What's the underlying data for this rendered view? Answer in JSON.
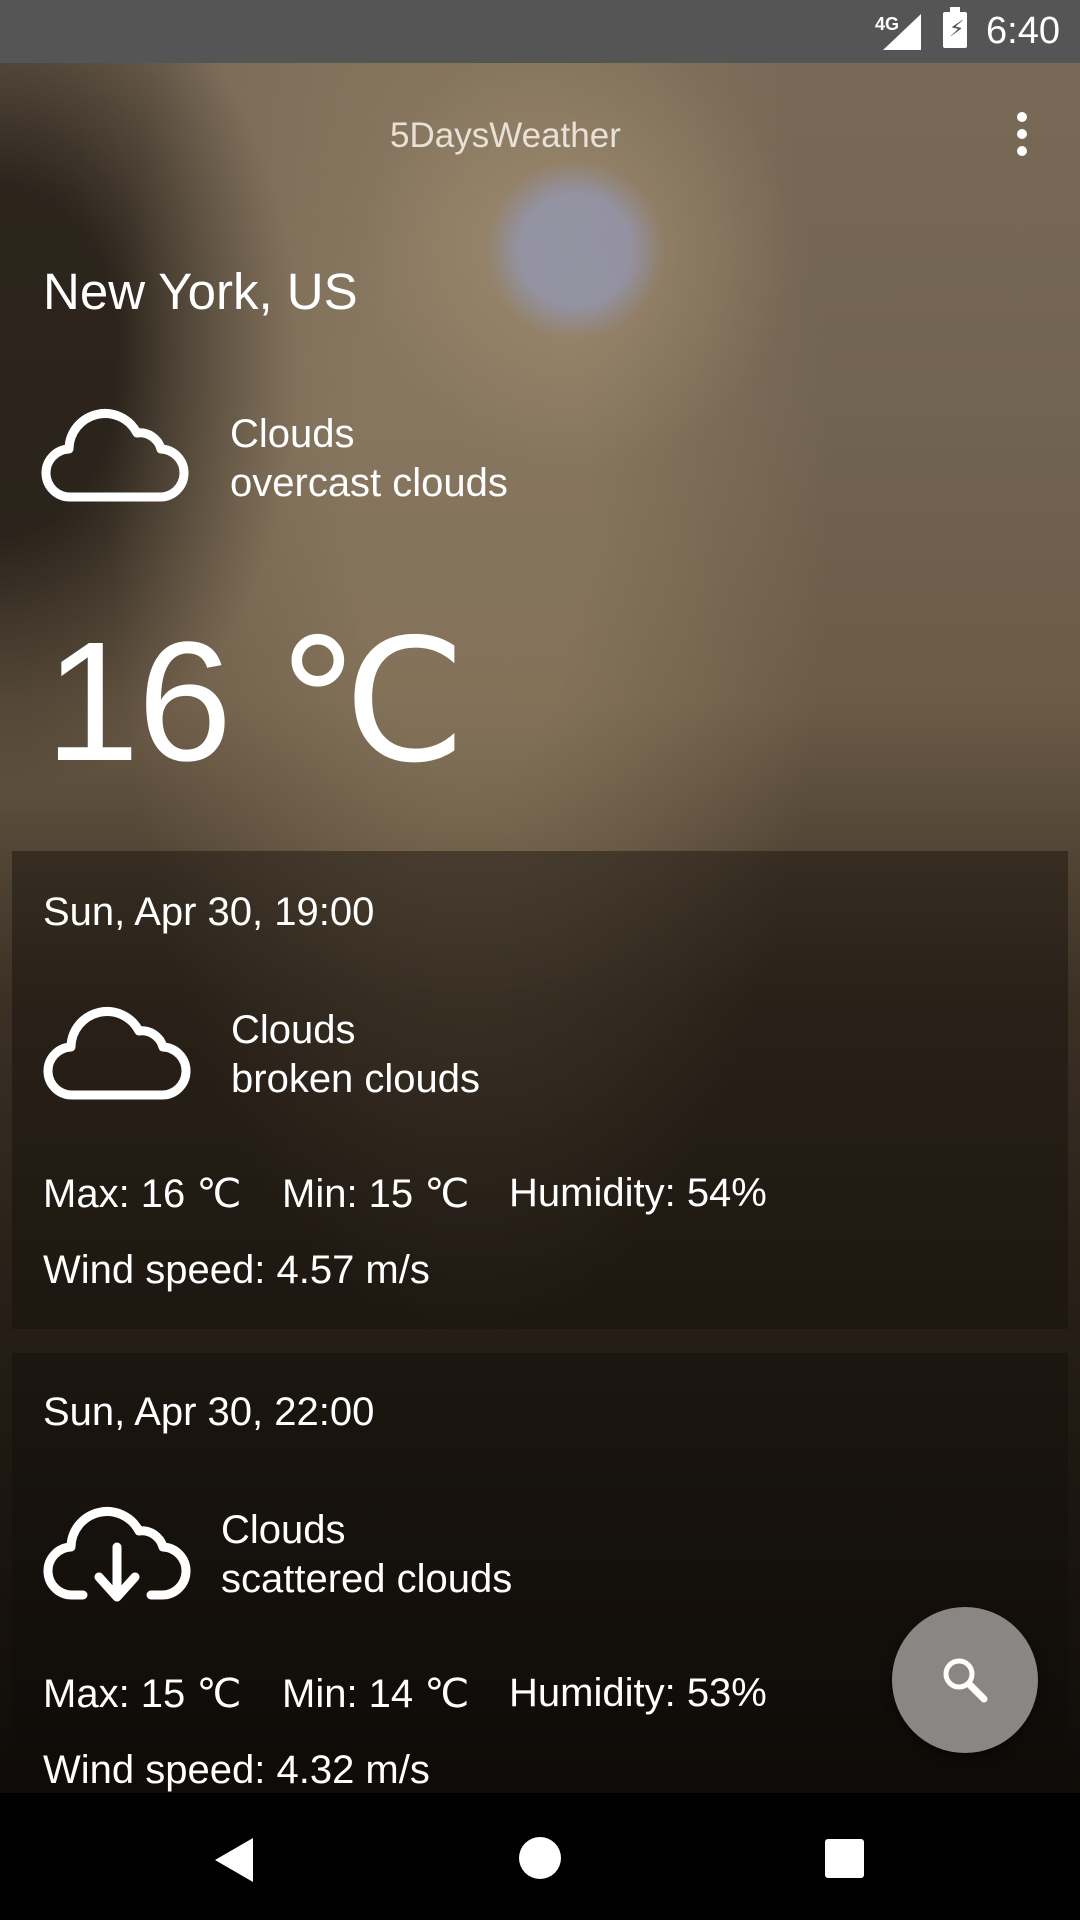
{
  "status_bar": {
    "network": "4G",
    "time": "6:40"
  },
  "toolbar": {
    "title": "5DaysWeather",
    "menu_icon": "more-vert-icon"
  },
  "current": {
    "city": "New York, US",
    "icon": "cloud-icon",
    "main": "Clouds",
    "description": "overcast clouds",
    "temperature": "16 ℃"
  },
  "forecast": [
    {
      "date": "Sun, Apr 30, 19:00",
      "icon": "cloud-icon",
      "main": "Clouds",
      "description": "broken clouds",
      "max": "Max: 16 ℃",
      "min": "Min: 15 ℃",
      "humidity": "Humidity: 54%",
      "wind": "Wind speed: 4.57 m/s"
    },
    {
      "date": "Sun, Apr 30, 22:00",
      "icon": "cloud-download-icon",
      "main": "Clouds",
      "description": "scattered clouds",
      "max": "Max: 15 ℃",
      "min": "Min: 14 ℃",
      "humidity": "Humidity: 53%",
      "wind": "Wind speed: 4.32 m/s"
    }
  ],
  "fab": {
    "icon": "search-icon"
  },
  "nav_bar": {
    "back_icon": "back-icon",
    "home_icon": "home-icon",
    "recents_icon": "recents-icon"
  }
}
